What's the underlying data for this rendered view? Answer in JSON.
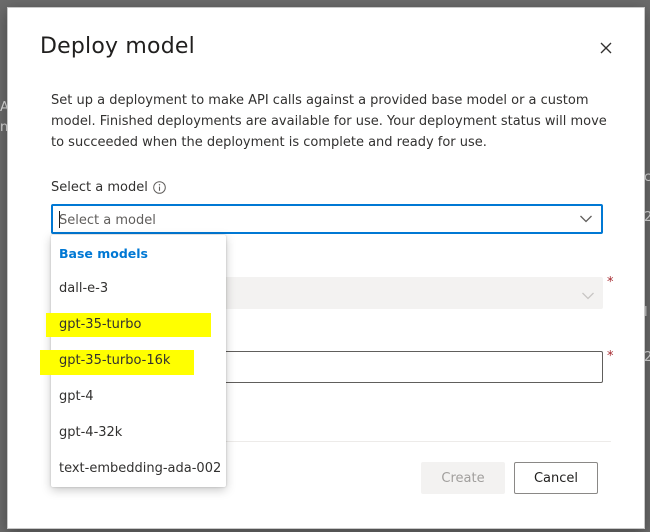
{
  "dialog": {
    "title": "Deploy model",
    "description": "Set up a deployment to make API calls against a provided base model or a custom model. Finished deployments are available for use. Your deployment status will move to succeeded when the deployment is complete and ready for use."
  },
  "model_field": {
    "label": "Select a model",
    "placeholder": "Select a model",
    "value": ""
  },
  "dropdown": {
    "group_label": "Base models",
    "options": [
      {
        "label": "dall-e-3",
        "highlighted": false
      },
      {
        "label": "gpt-35-turbo",
        "highlighted": true
      },
      {
        "label": "gpt-35-turbo-16k",
        "highlighted": true
      },
      {
        "label": "gpt-4",
        "highlighted": false
      },
      {
        "label": "gpt-4-32k",
        "highlighted": false
      },
      {
        "label": "text-embedding-ada-002",
        "highlighted": false
      }
    ]
  },
  "required_marker": "*",
  "buttons": {
    "create": "Create",
    "cancel": "Cancel"
  },
  "colors": {
    "accent": "#0078d4",
    "highlight": "#ffff00",
    "required": "#a4262c"
  }
}
